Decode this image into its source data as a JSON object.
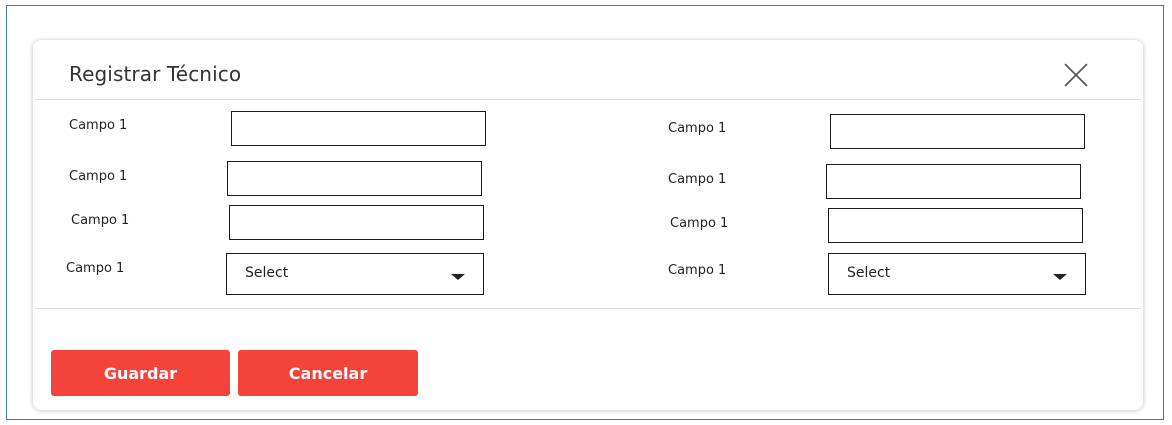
{
  "modal": {
    "title": "Registrar Técnico",
    "close_icon": "close-icon"
  },
  "form": {
    "left": [
      {
        "label": "Campo 1",
        "type": "input",
        "value": ""
      },
      {
        "label": "Campo 1",
        "type": "input",
        "value": ""
      },
      {
        "label": "Campo 1",
        "type": "input",
        "value": ""
      },
      {
        "label": "Campo 1",
        "type": "select",
        "value": "Select"
      }
    ],
    "right": [
      {
        "label": "Campo 1",
        "type": "input",
        "value": ""
      },
      {
        "label": "Campo 1",
        "type": "input",
        "value": ""
      },
      {
        "label": "Campo 1",
        "type": "input",
        "value": ""
      },
      {
        "label": "Campo 1",
        "type": "select",
        "value": "Select"
      }
    ]
  },
  "actions": {
    "save_label": "Guardar",
    "cancel_label": "Cancelar"
  },
  "colors": {
    "primary_button": "#f4433b",
    "frame_border": "#4a76b0"
  }
}
